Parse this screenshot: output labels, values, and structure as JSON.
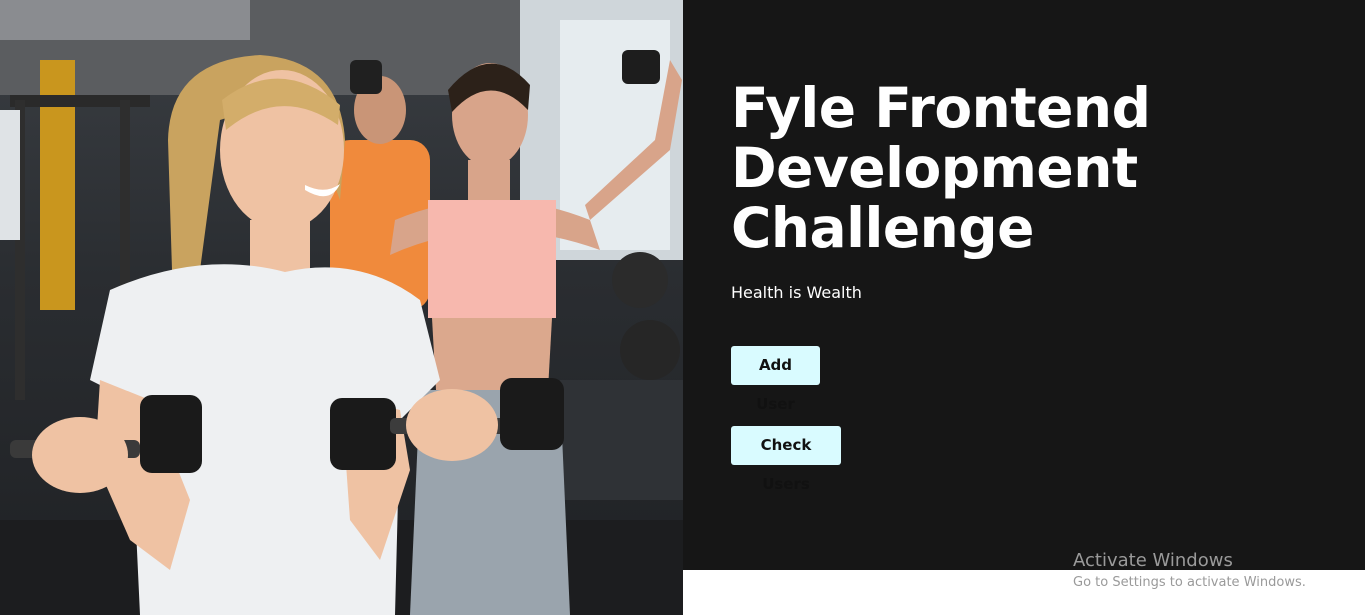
{
  "hero": {
    "image_name": "gym-women-with-dumbbells-photo"
  },
  "main": {
    "title": "Fyle Frontend Development Challenge",
    "tagline": "Health is Wealth",
    "buttons": {
      "add_user_label": "Add User",
      "check_users_label": "Check Users"
    }
  },
  "watermark": {
    "title": "Activate Windows",
    "subtitle": "Go to Settings to activate Windows."
  },
  "colors": {
    "panel_background": "#161616",
    "button_background": "#d9fbff",
    "button_text": "#111111",
    "heading_text": "#ffffff"
  }
}
